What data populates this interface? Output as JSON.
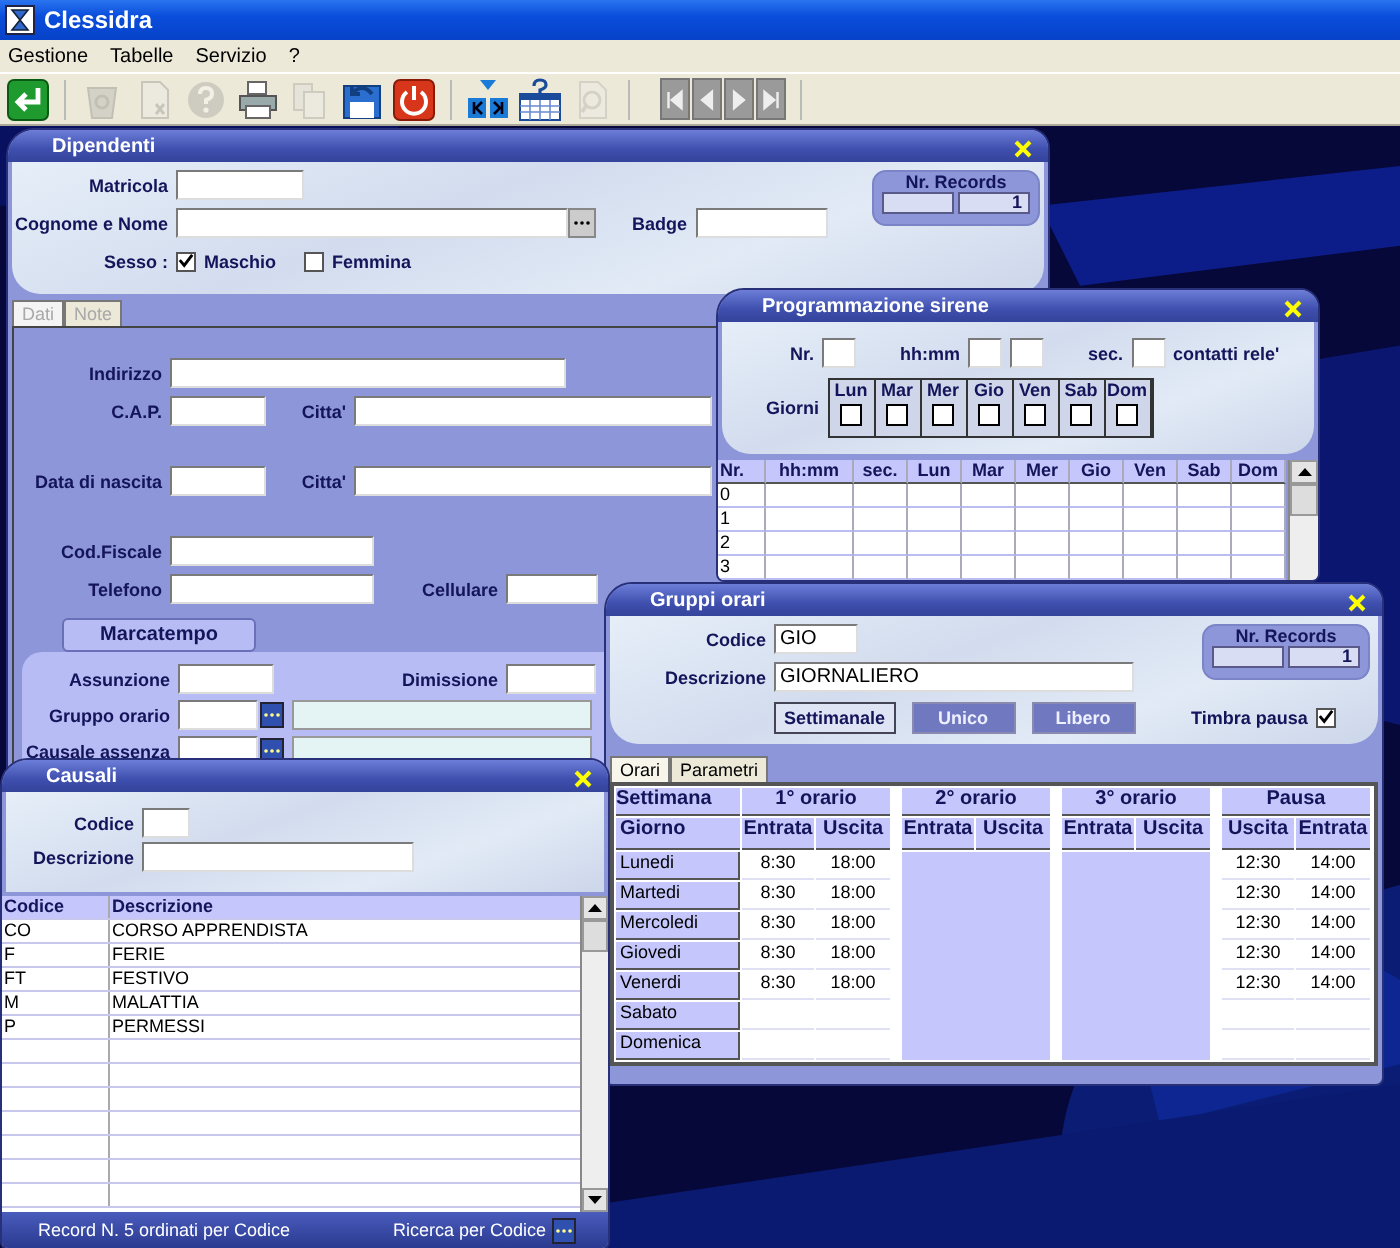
{
  "app_title": "Clessidra",
  "menu": [
    "Gestione",
    "Tabelle",
    "Servizio",
    "?"
  ],
  "toolbar": [
    {
      "kind": "enter",
      "disabled": false
    },
    {
      "kind": "recycle",
      "disabled": true
    },
    {
      "kind": "delete",
      "disabled": true
    },
    {
      "kind": "help",
      "disabled": true
    },
    {
      "kind": "print",
      "disabled": false
    },
    {
      "kind": "copy",
      "disabled": true
    },
    {
      "kind": "undo",
      "disabled": false
    },
    {
      "kind": "power",
      "disabled": false
    },
    {
      "kind": "filter",
      "disabled": false
    },
    {
      "kind": "calendar",
      "disabled": false
    },
    {
      "kind": "search",
      "disabled": true
    }
  ],
  "navigation": [
    {
      "kind": "first",
      "disabled": true
    },
    {
      "kind": "prev",
      "disabled": true
    },
    {
      "kind": "next",
      "disabled": true
    },
    {
      "kind": "last",
      "disabled": true
    }
  ],
  "dipendenti": {
    "title": "Dipendenti",
    "matricola": "Matricola",
    "cognome_nome": "Cognome e Nome",
    "badge": "Badge",
    "nr_records": {
      "label": "Nr. Records",
      "value": "1"
    },
    "sesso": {
      "label": "Sesso :",
      "options": [
        {
          "label": "Maschio",
          "checked": true
        },
        {
          "label": "Femmina",
          "checked": false
        }
      ]
    },
    "tabs": [
      {
        "label": "Dati",
        "selected": true
      },
      {
        "label": "Note",
        "selected": false
      }
    ],
    "indirizzo": "Indirizzo",
    "cap": "C.A.P.",
    "citta_1": "Citta'",
    "data_nascita": "Data di nascita",
    "citta_2": "Citta'",
    "cod_fiscale": "Cod.Fiscale",
    "telefono": "Telefono",
    "cellulare": "Cellulare",
    "marcatempo": {
      "title": "Marcatempo",
      "assunzione": "Assunzione",
      "dimissione": "Dimissione",
      "gruppo_orario": "Gruppo orario",
      "causale_assenza": "Causale assenza"
    }
  },
  "programmazione_sirene": {
    "title": "Programmazione sirene",
    "nr": "Nr.",
    "hhmm": "hh:mm",
    "sec": "sec.",
    "contatti": "contatti rele'",
    "giorni": "Giorni",
    "days": [
      {
        "label": "Lun",
        "checked": false
      },
      {
        "label": "Mar",
        "checked": false
      },
      {
        "label": "Mer",
        "checked": false
      },
      {
        "label": "Gio",
        "checked": false
      },
      {
        "label": "Ven",
        "checked": false
      },
      {
        "label": "Sab",
        "checked": false
      },
      {
        "label": "Dom",
        "checked": false
      }
    ],
    "table": {
      "columns": [
        "Nr.",
        "hh:mm",
        "sec.",
        "Lun",
        "Mar",
        "Mer",
        "Gio",
        "Ven",
        "Sab",
        "Dom"
      ],
      "rows": [
        "0",
        "1",
        "2",
        "3"
      ]
    }
  },
  "gruppi_orari": {
    "title": "Gruppi orari",
    "codice": {
      "label": "Codice",
      "value": "GIO"
    },
    "descrizione": {
      "label": "Descrizione",
      "value": "GIORNALIERO"
    },
    "nr_records": {
      "label": "Nr. Records",
      "value": "1"
    },
    "modes": [
      {
        "label": "Settimanale",
        "selected": true,
        "disabled": false
      },
      {
        "label": "Unico",
        "selected": false,
        "disabled": true
      },
      {
        "label": "Libero",
        "selected": false,
        "disabled": true
      }
    ],
    "timbra_pausa": {
      "label": "Timbra pausa",
      "checked": true
    },
    "tabs": [
      {
        "label": "Orari",
        "selected": true
      },
      {
        "label": "Parametri",
        "selected": false
      }
    ],
    "groups": [
      "Settimana",
      "1° orario",
      "2° orario",
      "3° orario",
      "Pausa"
    ],
    "subheaders": [
      "Giorno",
      "Entrata",
      "Uscita",
      "Entrata",
      "Uscita",
      "Entrata",
      "Uscita",
      "Uscita",
      "Entrata"
    ],
    "rows": [
      {
        "day": "Lunedi",
        "orario_1": [
          "8:30",
          "18:00"
        ],
        "pausa": [
          "12:30",
          "14:00"
        ]
      },
      {
        "day": "Martedi",
        "orario_1": [
          "8:30",
          "18:00"
        ],
        "pausa": [
          "12:30",
          "14:00"
        ]
      },
      {
        "day": "Mercoledi",
        "orario_1": [
          "8:30",
          "18:00"
        ],
        "pausa": [
          "12:30",
          "14:00"
        ]
      },
      {
        "day": "Giovedi",
        "orario_1": [
          "8:30",
          "18:00"
        ],
        "pausa": [
          "12:30",
          "14:00"
        ]
      },
      {
        "day": "Venerdi",
        "orario_1": [
          "8:30",
          "18:00"
        ],
        "pausa": [
          "12:30",
          "14:00"
        ]
      },
      {
        "day": "Sabato"
      },
      {
        "day": "Domenica"
      }
    ]
  },
  "causali": {
    "title": "Causali",
    "codice": "Codice",
    "descrizione": "Descrizione",
    "columns": [
      "Codice",
      "Descrizione"
    ],
    "rows": [
      [
        "CO",
        "CORSO APPRENDISTA"
      ],
      [
        "F",
        "FERIE"
      ],
      [
        "FT",
        "FESTIVO"
      ],
      [
        "M",
        "MALATTIA"
      ],
      [
        "P",
        "PERMESSI"
      ]
    ],
    "status": "Record N. 5 ordinati per Codice",
    "search": "Ricerca per Codice"
  }
}
